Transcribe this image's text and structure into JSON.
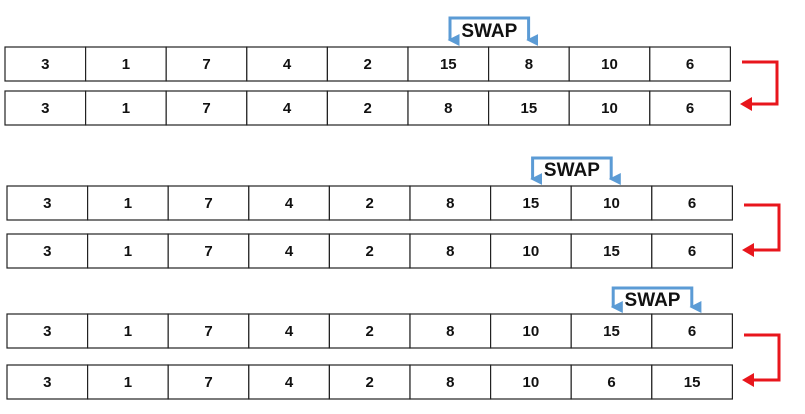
{
  "colors": {
    "swap_arrow": "#5b9bd5",
    "transition_arrow": "#e8161c",
    "cell_border": "#222222",
    "text": "#111111"
  },
  "icons": {
    "swap": "blue-bracket-swap-arrow",
    "transition": "red-elbow-arrow"
  },
  "swap_label": "SWAP",
  "steps": [
    {
      "swap_indices": [
        5,
        6
      ],
      "before": [
        "3",
        "1",
        "7",
        "4",
        "2",
        "15",
        "8",
        "10",
        "6"
      ],
      "after": [
        "3",
        "1",
        "7",
        "4",
        "2",
        "8",
        "15",
        "10",
        "6"
      ]
    },
    {
      "swap_indices": [
        6,
        7
      ],
      "before": [
        "3",
        "1",
        "7",
        "4",
        "2",
        "8",
        "15",
        "10",
        "6"
      ],
      "after": [
        "3",
        "1",
        "7",
        "4",
        "2",
        "8",
        "10",
        "15",
        "6"
      ]
    },
    {
      "swap_indices": [
        7,
        8
      ],
      "before": [
        "3",
        "1",
        "7",
        "4",
        "2",
        "8",
        "10",
        "15",
        "6"
      ],
      "after": [
        "3",
        "1",
        "7",
        "4",
        "2",
        "8",
        "10",
        "6",
        "15"
      ]
    }
  ]
}
